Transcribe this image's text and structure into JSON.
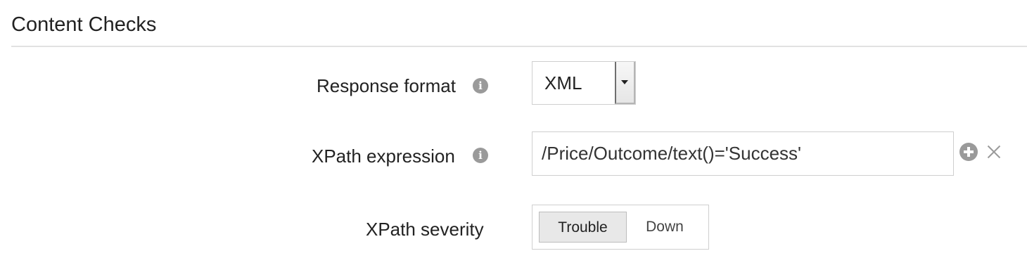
{
  "section": {
    "title": "Content Checks"
  },
  "fields": {
    "response_format": {
      "label": "Response format",
      "info_icon": "info-icon",
      "selected_value": "XML"
    },
    "xpath_expression": {
      "label": "XPath expression",
      "info_icon": "info-icon",
      "value": "/Price/Outcome/text()='Success'",
      "add_icon": "plus-circle-icon",
      "remove_icon": "close-icon"
    },
    "xpath_severity": {
      "label": "XPath severity",
      "options": [
        "Trouble",
        "Down"
      ],
      "selected": "Trouble"
    }
  },
  "colors": {
    "icon_gray": "#9a9a9a",
    "border": "#cfcfcf",
    "active_toggle_bg": "#e8e8e8"
  }
}
